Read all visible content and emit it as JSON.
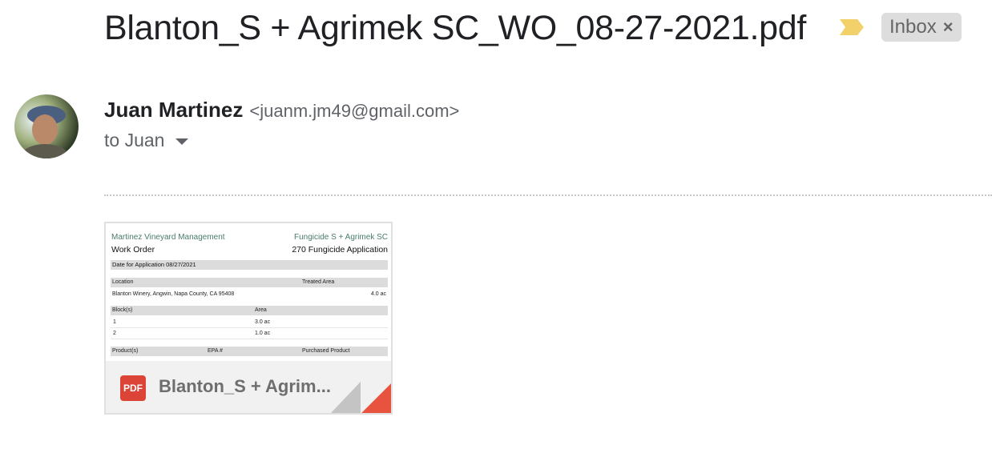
{
  "email": {
    "subject": "Blanton_S + Agrimek SC_WO_08-27-2021.pdf",
    "importance_color": "#f2d16b",
    "label": {
      "text": "Inbox",
      "close": "×"
    },
    "sender": {
      "name": "Juan Martinez",
      "email": "<juanm.jm49@gmail.com>"
    },
    "recipients": "to Juan"
  },
  "attachment": {
    "name": "Blanton_S + Agrim...",
    "type_badge": "PDF",
    "badge_color": "#db4437",
    "preview": {
      "company": "Martinez Vineyard Management",
      "product": "Fungicide S + Agrimek SC",
      "doc_type": "Work Order",
      "application": "270 Fungicide Application",
      "date": "Date for Application 08/27/2021",
      "location_header": "Location",
      "treated_area_header": "Treated Area",
      "location": "Blanton Winery, Angwin, Napa County, CA 95408",
      "treated_area": "4.0 ac",
      "blocks_header": "Block(s)",
      "area_header": "Area",
      "blocks": [
        {
          "block": "1",
          "area": "3.0 ac"
        },
        {
          "block": "2",
          "area": "1.0 ac"
        }
      ],
      "products_header": "Product(s)",
      "epa_header": "EPA #",
      "purchased_header": "Purchased Product"
    }
  }
}
